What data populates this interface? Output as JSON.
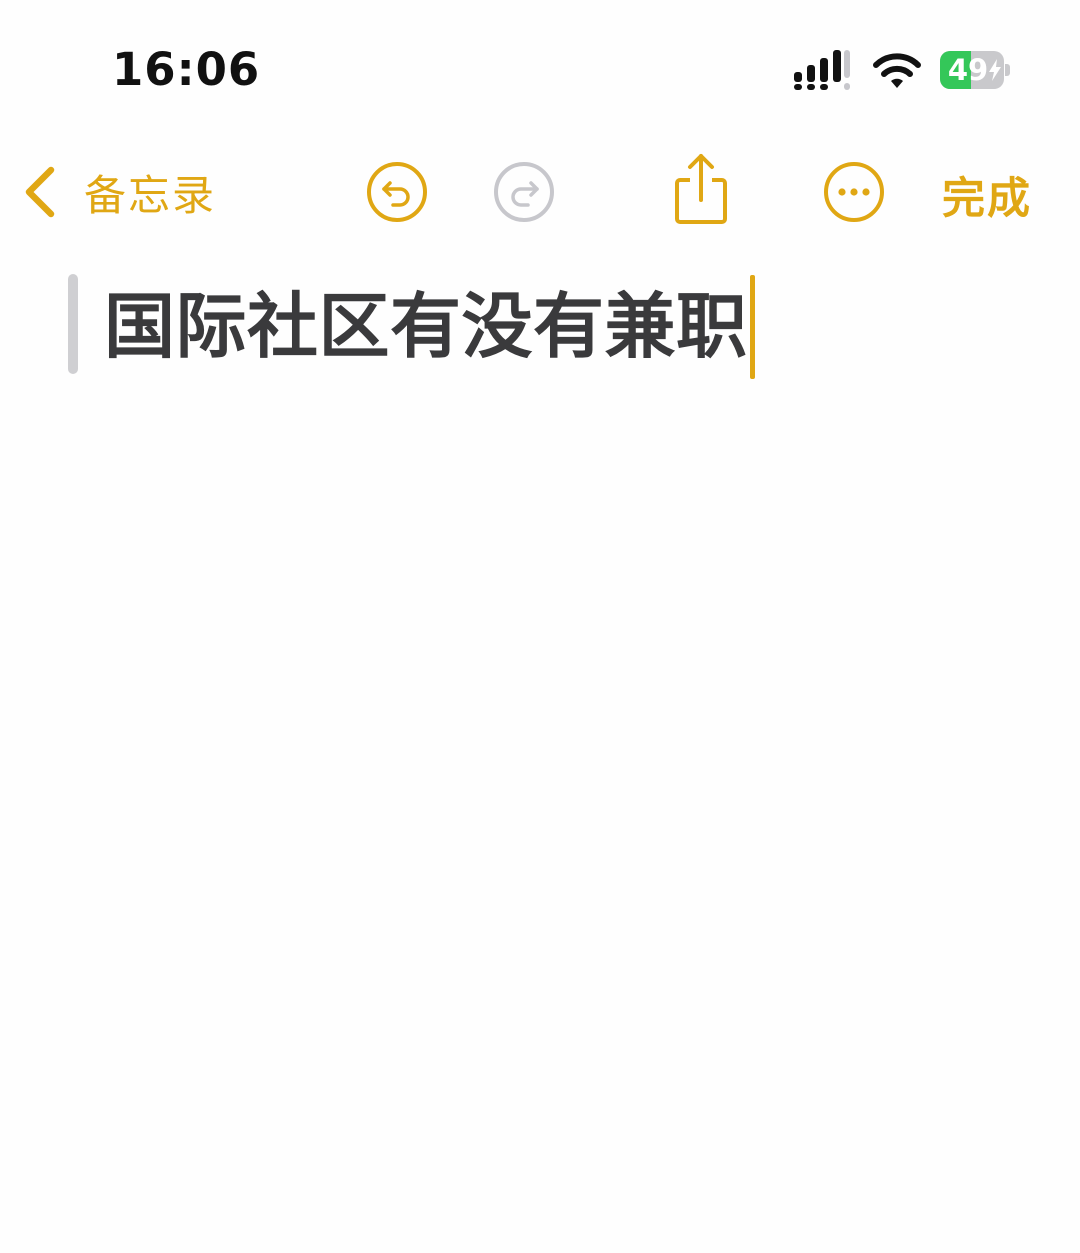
{
  "status_bar": {
    "time": "16:06",
    "battery_level": "49",
    "battery_percent": 49,
    "battery_charging": true,
    "signal_icon": "cellular-signal-icon",
    "wifi_icon": "wifi-icon"
  },
  "toolbar": {
    "back_label": "备忘录",
    "back_icon": "chevron-left-icon",
    "undo_icon": "undo-icon",
    "redo_icon": "redo-icon",
    "redo_enabled": false,
    "share_icon": "share-icon",
    "more_icon": "ellipsis-circle-icon",
    "done_label": "完成"
  },
  "note": {
    "title": "国际社区有没有兼职"
  },
  "colors": {
    "accent": "#e0a714",
    "disabled": "#c7c7cc",
    "title_text": "#3a3a3c",
    "battery_green": "#34c759"
  }
}
